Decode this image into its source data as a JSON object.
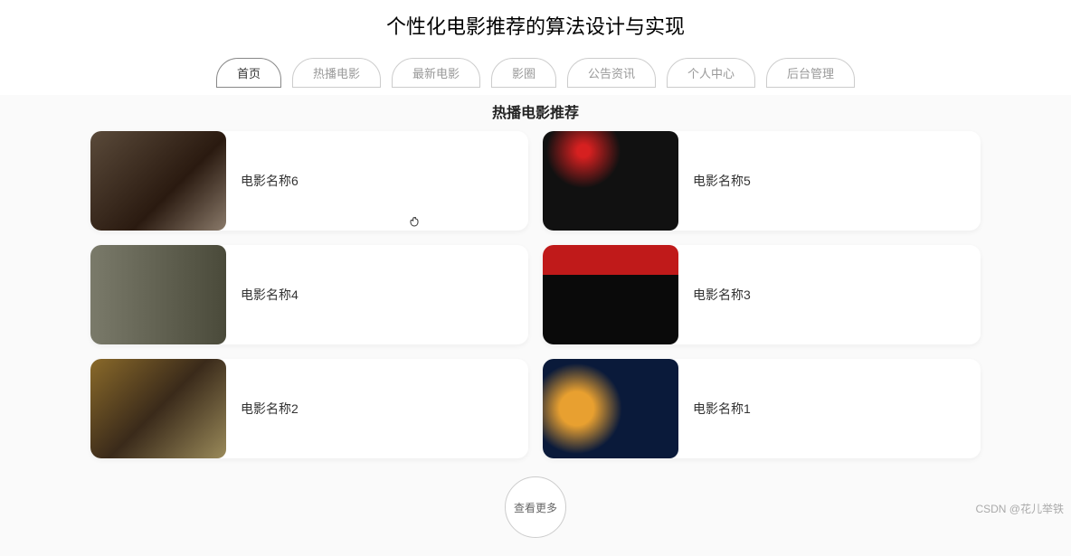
{
  "page_title": "个性化电影推荐的算法设计与实现",
  "nav": [
    {
      "label": "首页",
      "active": true
    },
    {
      "label": "热播电影",
      "active": false
    },
    {
      "label": "最新电影",
      "active": false
    },
    {
      "label": "影圈",
      "active": false
    },
    {
      "label": "公告资讯",
      "active": false
    },
    {
      "label": "个人中心",
      "active": false
    },
    {
      "label": "后台管理",
      "active": false
    }
  ],
  "section_title": "热播电影推荐",
  "movies": [
    {
      "title": "电影名称6",
      "poster_class": "p6"
    },
    {
      "title": "电影名称5",
      "poster_class": "p5"
    },
    {
      "title": "电影名称4",
      "poster_class": "p4"
    },
    {
      "title": "电影名称3",
      "poster_class": "p3"
    },
    {
      "title": "电影名称2",
      "poster_class": "p2"
    },
    {
      "title": "电影名称1",
      "poster_class": "p1"
    }
  ],
  "view_more_label": "查看更多",
  "watermark": "CSDN @花儿举铁"
}
